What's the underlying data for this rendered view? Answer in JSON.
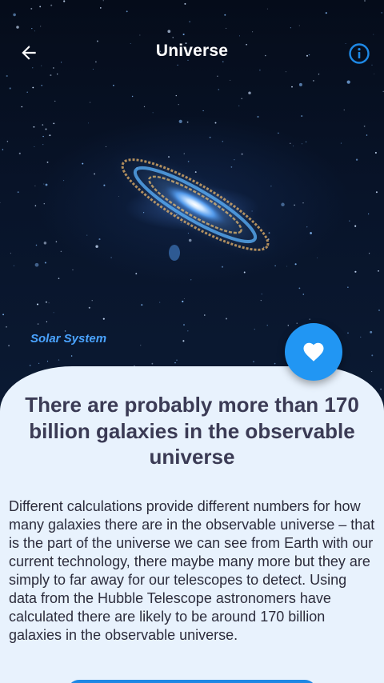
{
  "header": {
    "title": "Universe",
    "back_icon": "arrow-left-icon",
    "info_icon": "info-circle-icon"
  },
  "hero": {
    "image": "andromeda-galaxy-image",
    "category": "Solar System"
  },
  "fab": {
    "icon": "heart-icon"
  },
  "fact": {
    "headline": "There are probably more than 170 billion galaxies in the observable universe",
    "body": "Different calculations provide different numbers for how many galaxies there are in the observable universe – that is the part of the universe we can see from Earth with our current technology, there maybe many more but they are simply to far away for our telescopes to detect. Using data from the Hubble Telescope astronomers have calculated there are likely to be around 170 billion galaxies in the observable universe."
  },
  "colors": {
    "accent": "#2196f3",
    "info_icon": "#1e88e5",
    "category_text": "#4aa3ff",
    "sheet_background": "#e8f2fd",
    "headline_text": "#3b3b55"
  }
}
